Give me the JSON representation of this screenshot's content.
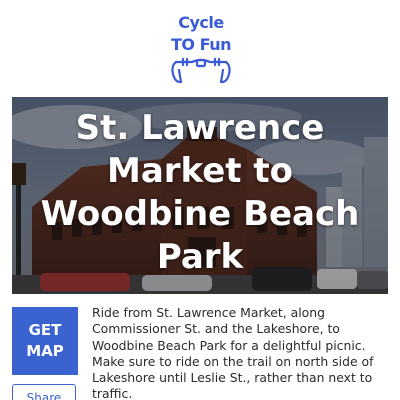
{
  "logo": {
    "line1": "Cycle",
    "line2": "TO Fun",
    "icon": "handlebars-icon",
    "color": "#3b5bd6"
  },
  "hero": {
    "title": "St. Lawrence Market to Woodbine Beach Park",
    "image": "st-lawrence-market-building-photo"
  },
  "actions": {
    "get_map_label": "GET\nMAP",
    "share_label": "Share",
    "accent": "#3b63cf"
  },
  "route": {
    "description": "Ride from St. Lawrence Market, along Commissioner St. and the Lakeshore, to Woodbine Beach Park for a delightful picnic. Make sure to ride on the trail on north side of Lakeshore until Leslie St., rather than next to traffic."
  }
}
